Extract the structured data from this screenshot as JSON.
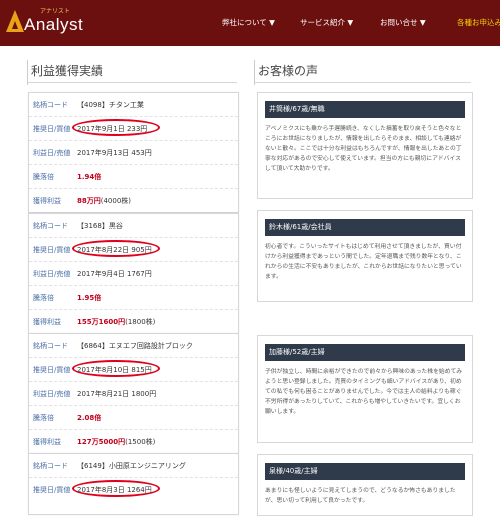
{
  "brand": {
    "logo_text": "Analyst",
    "logo_kana": "アナリスト",
    "logo_color": "#e8a317",
    "header_bg": "#6b0f0f"
  },
  "nav": [
    {
      "label": "弊社について ▼",
      "active": false
    },
    {
      "label": "サービス紹介 ▼",
      "active": false
    },
    {
      "label": "お問い合せ ▼",
      "active": false
    },
    {
      "label": "各種お申込み ▼",
      "active": true
    }
  ],
  "sections": {
    "left_title": "利益獲得実績",
    "right_title": "お客様の声"
  },
  "results": [
    {
      "code_label": "銘柄コード",
      "code_value": "【4098】チタン工業",
      "buy_label": "推奨日/買値",
      "buy_value": "2017年9月1日 233円",
      "sell_label": "利益日/売値",
      "sell_value": "2017年9月13日 453円",
      "mult_label": "騰落倍",
      "mult_value": "1.94倍",
      "profit_label": "獲得利益",
      "profit_value": "88万円",
      "profit_unit": "(4000株)"
    },
    {
      "code_label": "銘柄コード",
      "code_value": "【3168】黒谷",
      "buy_label": "推奨日/買値",
      "buy_value": "2017年8月22日 905円",
      "sell_label": "利益日/売値",
      "sell_value": "2017年9月4日 1767円",
      "mult_label": "騰落倍",
      "mult_value": "1.95倍",
      "profit_label": "獲得利益",
      "profit_value": "155万1600円",
      "profit_unit": "(1800株)"
    },
    {
      "code_label": "銘柄コード",
      "code_value": "【6864】エヌエフ回路設計ブロック",
      "buy_label": "推奨日/買値",
      "buy_value": "2017年8月10日 815円",
      "sell_label": "利益日/売値",
      "sell_value": "2017年8月21日 1800円",
      "mult_label": "騰落倍",
      "mult_value": "2.08倍",
      "profit_label": "獲得利益",
      "profit_value": "127万5000円",
      "profit_unit": "(1500株)"
    },
    {
      "code_label": "銘柄コード",
      "code_value": "【6149】小田原エンジニアリング",
      "buy_label": "推奨日/買値",
      "buy_value": "2017年8月3日 1264円"
    }
  ],
  "voices": [
    {
      "header": "井筒様/67歳/無職",
      "body": "アベノミクスにも乗から手遅勝続き、なくした損蓄を取り戻そうと色々なところにお世話になりましたが、情報を出したらそのまま、相談しても連絡がないと散々。ここでは十分な利益はもちろんですが、情報を出したあとの丁寧な対応があるので安心して使えています。担当の方にも親切にアドバイスして頂いて大助かりです。"
    },
    {
      "header": "鈴木様/61歳/会社員",
      "body": "初心者です。こういったサイトもはじめて利用させて頂きましたが、買い付けから利益獲得まであっという間でした。定年退職まで残り数年となり、これからの生活に不安もありましたが、これからお世話になりたいと思っています。"
    },
    {
      "header": "加藤様/52歳/主婦",
      "body": "子供が独立し、時間に余裕ができたので前々から興味のあった株を始めてみようと思い登録しました。売買のタイミングも細いアドバイスがあり、初めての私でも何も困ることがありませんでした。今では主人の給料よりも稼ぐ不労所得があったりしていて、これからも増やしていきたいです。宜しくお願いします。"
    },
    {
      "header": "泉様/40歳/主婦",
      "body": "あまりにも怪しいように見えてしまうので、どうなるか怖さもありましたが、思い切って利用して良かったです。"
    }
  ]
}
